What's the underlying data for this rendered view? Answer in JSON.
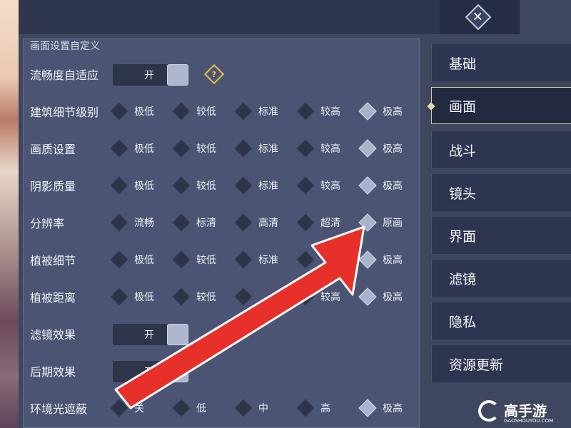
{
  "section_title": "画面设置自定义",
  "close": {
    "glyph": "✕"
  },
  "help_icon": {
    "glyph": "?"
  },
  "rows": [
    {
      "label": "流畅度自适应",
      "type": "toggle",
      "value": "开"
    },
    {
      "label": "建筑细节级别",
      "type": "options",
      "options": [
        "极低",
        "较低",
        "标准",
        "较高",
        "极高"
      ],
      "selected": "极高"
    },
    {
      "label": "画质设置",
      "type": "options",
      "options": [
        "极低",
        "较低",
        "标准",
        "较高",
        "极高"
      ],
      "selected": "极高"
    },
    {
      "label": "阴影质量",
      "type": "options",
      "options": [
        "极低",
        "较低",
        "标准",
        "较高",
        "极高"
      ],
      "selected": "极高"
    },
    {
      "label": "分辨率",
      "type": "options",
      "options": [
        "流畅",
        "标清",
        "高清",
        "超清",
        "原画"
      ],
      "selected": "原画"
    },
    {
      "label": "植被细节",
      "type": "options",
      "options": [
        "极低",
        "较低",
        "标准",
        "",
        "极高"
      ],
      "selected": "极高"
    },
    {
      "label": "植被距离",
      "type": "options",
      "options": [
        "极低",
        "较低",
        "",
        "较高",
        "极高"
      ],
      "selected": "极高"
    },
    {
      "label": "滤镜效果",
      "type": "toggle",
      "value": "开"
    },
    {
      "label": "后期效果",
      "type": "toggle",
      "value": "开"
    },
    {
      "label": "环境光遮蔽",
      "type": "options",
      "options": [
        "关",
        "低",
        "中",
        "高",
        "极高"
      ],
      "selected": "极高"
    }
  ],
  "sidebar": {
    "items": [
      {
        "label": "基础",
        "active": false
      },
      {
        "label": "画面",
        "active": true
      },
      {
        "label": "战斗",
        "active": false
      },
      {
        "label": "镜头",
        "active": false
      },
      {
        "label": "界面",
        "active": false
      },
      {
        "label": "滤镜",
        "active": false
      },
      {
        "label": "隐私",
        "active": false
      },
      {
        "label": "资源更新",
        "active": false
      }
    ]
  },
  "watermark": {
    "brand": "高手游",
    "url": "GAOSHOUYOU.COM"
  },
  "colors": {
    "arrow": "#e8302a",
    "selected_diamond": "#aab3cc",
    "help_icon": "#e6c24a",
    "active_border": "#d8c89a"
  }
}
